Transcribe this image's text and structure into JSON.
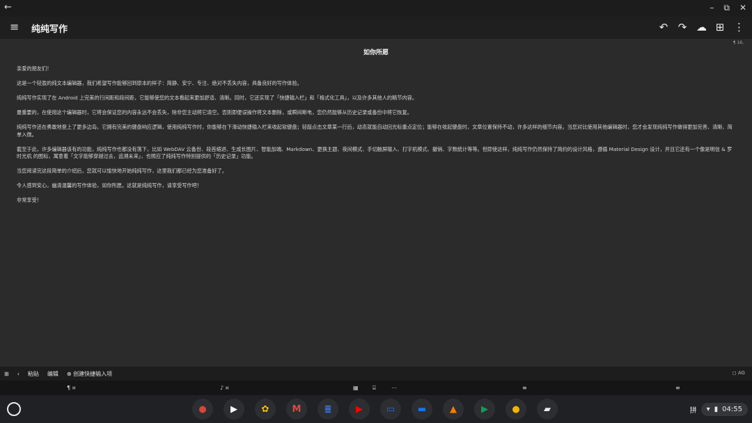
{
  "window": {
    "back_glyph": "←",
    "min_glyph": "–",
    "restore_glyph": "⧉",
    "close_glyph": "✕"
  },
  "appbar": {
    "menu_glyph": "≡",
    "title": "纯纯写作",
    "undo_glyph": "↶",
    "redo_glyph": "↷",
    "cloud_glyph": "☁",
    "grid_glyph": "⊞",
    "more_glyph": "⋮"
  },
  "document": {
    "counter": "¶ 16,",
    "title": "如你所愿",
    "paragraphs": [
      "亲爱的朋友们！",
      "这是一个轻盈的纯文本编辑器，我们希望写作能够回到原本的样子：简静、安宁、专注、绝对不丢失内容，具备良好的写作体验。",
      "纯纯写作实现了在 Android 上完美的行间距和段间距，它能够使您的文本看起来更加舒适、清晰。同时，它还实现了「快捷输入栏」和「格式化工具」，以及许多其他人的精节内容。",
      "最重要的，在使用这个编辑器时，它将会保证您的内容永远不会丢失，除非您主动将它清空。否则即便误操作将文本删除，或瞬间断电，您仍然能够从历史记录或备份中将它恢复。",
      "纯纯写作还在勇敢地登上了更多边岛，它拥有完美的键盘响应逻辑，使用纯纯写作时，你能够在下滑动快捷输入栏来收起软键盘；轻敲点击文章某一行后，动态就能自动回光标重点定位；能够在收起键盘时，文章位置保持不动，许多这样的细节内容。当您对比使用其他编辑器时，您才会发现纯纯写作做得更加完善、清晰、简单入微。",
      "截至于此，许多编辑器该有的功能，纯纯写作也都没有落下，比如 WebDAV 云备份、段首缩进、生成长图片、智能加端、Markdown、更换主题、夜间模式、手切触屏输入、打字机模式、撤销、字数统计等等。但即使这样，纯纯写作仍然保持了简约的设计风格，遵循 Material Design 设计，并且它还有一个像是明信 & 罗 时光机 的图标，寓意着「文字能够穿越过去，追溯未来」，也照应了纯纯写作特别提供的「历史记录」功能。",
      "当您阅读完这段简单的介绍后，您就可以愉快地开始纯纯写作，这里我们都已经为您准备好了。",
      "令人感到安心，幽清温馨的写作体验，如你所愿。这就是纯纯写作，请享受写作吧！",
      "非常享受！"
    ]
  },
  "edit_toolbar": {
    "toggle_glyph": "⊞",
    "prev_glyph": "‹",
    "paste_label": "粘贴",
    "cut_label": "编辑",
    "add_label": "⊕ 创建快捷输入项",
    "right_label": "◻ AG"
  },
  "strip": {
    "a": "¶ ¤",
    "b": "♪ ¤",
    "c": "▦",
    "d": "⌸",
    "e": "⋯",
    "f": "≡",
    "g": "≡"
  },
  "shelf": {
    "apps": [
      {
        "name": "chrome",
        "glyph": "●",
        "color": "#db4437"
      },
      {
        "name": "play-store",
        "glyph": "▶",
        "color": "#ffffff"
      },
      {
        "name": "photos",
        "glyph": "✿",
        "color": "#fbbc04"
      },
      {
        "name": "gmail",
        "glyph": "M",
        "color": "#ea4335"
      },
      {
        "name": "docs",
        "glyph": "≣",
        "color": "#4285f4"
      },
      {
        "name": "youtube",
        "glyph": "▶",
        "color": "#ff0000"
      },
      {
        "name": "files",
        "glyph": "▭",
        "color": "#1a73e8"
      },
      {
        "name": "messages",
        "glyph": "▬",
        "color": "#1a73e8"
      },
      {
        "name": "vlc",
        "glyph": "▲",
        "color": "#f57c00"
      },
      {
        "name": "play-games",
        "glyph": "▶",
        "color": "#0f9d58"
      },
      {
        "name": "chrome-canary",
        "glyph": "●",
        "color": "#f4b400"
      },
      {
        "name": "file-manager",
        "glyph": "▰",
        "color": "#e8eaed"
      }
    ],
    "ime": "拼",
    "wifi_glyph": "▾",
    "battery_glyph": "▮",
    "time": "04:55"
  }
}
